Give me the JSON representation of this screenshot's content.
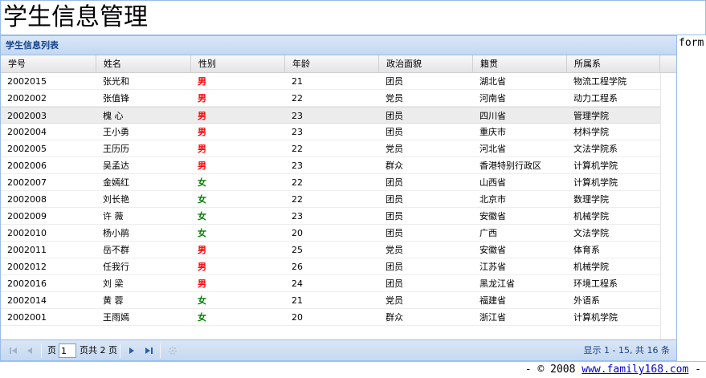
{
  "header": {
    "title": "学生信息管理"
  },
  "panel": {
    "title": "学生信息列表"
  },
  "form_label": "form",
  "columns": [
    "学号",
    "姓名",
    "性别",
    "年龄",
    "政治面貌",
    "籍贯",
    "所属系"
  ],
  "rows": [
    {
      "id": "2002015",
      "name": "张光和",
      "gender": "男",
      "age": "21",
      "political": "团员",
      "origin": "湖北省",
      "dept": "物流工程学院"
    },
    {
      "id": "2002002",
      "name": "张值锋",
      "gender": "男",
      "age": "22",
      "political": "党员",
      "origin": "河南省",
      "dept": "动力工程系"
    },
    {
      "id": "2002003",
      "name": "槐 心",
      "gender": "男",
      "age": "23",
      "political": "团员",
      "origin": "四川省",
      "dept": "管理学院"
    },
    {
      "id": "2002004",
      "name": "王小勇",
      "gender": "男",
      "age": "23",
      "political": "团员",
      "origin": "重庆市",
      "dept": "材料学院"
    },
    {
      "id": "2002005",
      "name": "王历历",
      "gender": "男",
      "age": "22",
      "political": "党员",
      "origin": "河北省",
      "dept": "文法学院系"
    },
    {
      "id": "2002006",
      "name": "吴孟达",
      "gender": "男",
      "age": "23",
      "political": "群众",
      "origin": "香港特别行政区",
      "dept": "计算机学院"
    },
    {
      "id": "2002007",
      "name": "金嫣红",
      "gender": "女",
      "age": "22",
      "political": "团员",
      "origin": "山西省",
      "dept": "计算机学院"
    },
    {
      "id": "2002008",
      "name": "刘长艳",
      "gender": "女",
      "age": "22",
      "political": "团员",
      "origin": "北京市",
      "dept": "数理学院"
    },
    {
      "id": "2002009",
      "name": "许 薇",
      "gender": "女",
      "age": "23",
      "political": "团员",
      "origin": "安徽省",
      "dept": "机械学院"
    },
    {
      "id": "2002010",
      "name": "杨小鹃",
      "gender": "女",
      "age": "20",
      "political": "团员",
      "origin": "广西",
      "dept": "文法学院"
    },
    {
      "id": "2002011",
      "name": "岳不群",
      "gender": "男",
      "age": "25",
      "political": "党员",
      "origin": "安徽省",
      "dept": "体育系"
    },
    {
      "id": "2002012",
      "name": "任我行",
      "gender": "男",
      "age": "26",
      "political": "团员",
      "origin": "江苏省",
      "dept": "机械学院"
    },
    {
      "id": "2002016",
      "name": "刘 梁",
      "gender": "男",
      "age": "24",
      "political": "团员",
      "origin": "黑龙江省",
      "dept": "环境工程系"
    },
    {
      "id": "2002014",
      "name": "黄 蓉",
      "gender": "女",
      "age": "21",
      "political": "党员",
      "origin": "福建省",
      "dept": "外语系"
    },
    {
      "id": "2002001",
      "name": "王雨嫣",
      "gender": "女",
      "age": "20",
      "political": "群众",
      "origin": "浙江省",
      "dept": "计算机学院"
    }
  ],
  "selected_row_index": 2,
  "colors": {
    "male": "#ff0000",
    "female": "#008000",
    "accent": "#15428b",
    "panel_border": "#99bbe8"
  },
  "pager": {
    "first_icon": "first-page-icon",
    "prev_icon": "prev-page-icon",
    "next_icon": "next-page-icon",
    "last_icon": "last-page-icon",
    "refresh_icon": "refresh-icon",
    "page_label": "页",
    "current_page": "1",
    "total_label": "页共 2 页",
    "display_msg": "显示 1 - 15, 共 16 条"
  },
  "footer": {
    "prefix": "- © 2008 ",
    "link": "www.family168.com",
    "suffix": " -"
  }
}
